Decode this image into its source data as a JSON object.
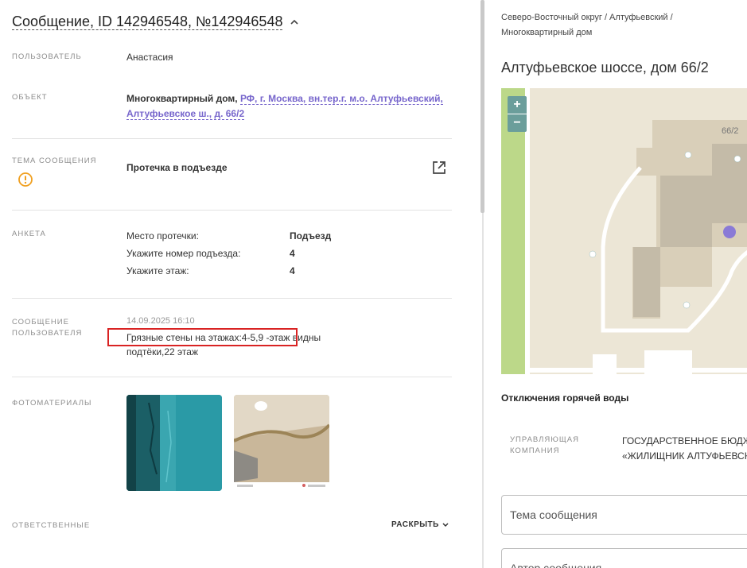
{
  "header": {
    "title": "Сообщение, ID 142946548, №142946548"
  },
  "fields": {
    "user_label": "ПОЛЬЗОВАТЕЛЬ",
    "user_value": "Анастасия",
    "object_label": "ОБЪЕКТ",
    "object_type": "Многоквартирный дом,",
    "object_address_line1": "РФ, г. Москва, вн.тер.г. м.о. Алтуфьевский,",
    "object_address_line2": "Алтуфьевское ш., д. 66/2",
    "topic_label": "ТЕМА СООБЩЕНИЯ",
    "topic_value": "Протечка в подъезде",
    "survey_label": "АНКЕТА",
    "message_label_line1": "СООБЩЕНИЕ",
    "message_label_line2": "ПОЛЬЗОВАТЕЛЯ",
    "message_date": "14.09.2025 16:10",
    "message_text": "Грязные стены на этажах:4-5,9 -этаж видны подтёки,22 этаж",
    "photos_label": "ФОТОМАТЕРИАЛЫ",
    "responsible_label": "ОТВЕТСТВЕННЫЕ",
    "expand_label": "РАСКРЫТЬ"
  },
  "survey": [
    {
      "question": "Место протечки:",
      "answer": "Подъезд"
    },
    {
      "question": "Укажите номер подъезда:",
      "answer": "4"
    },
    {
      "question": "Укажите этаж:",
      "answer": "4"
    }
  ],
  "right_panel": {
    "breadcrumb_line1": "Северо-Восточный округ / Алтуфьевский /",
    "breadcrumb_line2": "Многоквартирный дом",
    "address": "Алтуфьевское шоссе, дом 66/2",
    "map_house_number": "66/2",
    "zoom_in": "+",
    "zoom_out": "−",
    "hot_water_title": "Отключения горячей воды",
    "uk_label_line1": "УПРАВЛЯЮЩАЯ",
    "uk_label_line2": "КОМПАНИЯ",
    "uk_value_line1": "ГОСУДАРСТВЕННОЕ БЮДЖ",
    "uk_value_line2": "«ЖИЛИЩНИК АЛТУФЬЕВСК",
    "topic_field_placeholder": "Тема сообщения",
    "author_field_placeholder": "Автор сообщения"
  },
  "colors": {
    "accent_link": "#7766cc",
    "warning": "#f0a020",
    "highlight": "#d92323"
  }
}
